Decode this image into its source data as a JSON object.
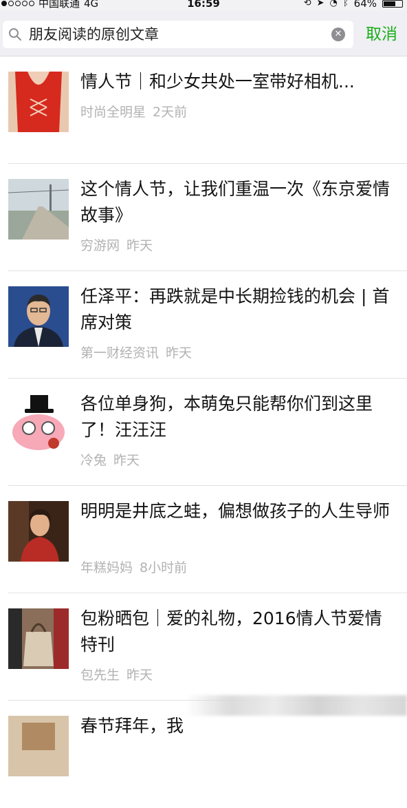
{
  "status_bar": {
    "carrier": "中国联通",
    "network": "4G",
    "time": "16:59",
    "battery": "64%",
    "battery_level": 0.64,
    "signal_bars_filled": 1,
    "signal_bars_total": 5
  },
  "search": {
    "query": "朋友阅读的原创文章",
    "cancel_label": "取消"
  },
  "colors": {
    "accent_green": "#1aad19",
    "meta_gray": "#b2b2b2"
  },
  "results": [
    {
      "title": "情人节｜和少女共处一室带好相机...",
      "source": "时尚全明星",
      "time": "2天前",
      "thumb": "red-dress"
    },
    {
      "title": "这个情人节，让我们重温一次《东京爱情故事》",
      "source": "穷游网",
      "time": "昨天",
      "thumb": "railway"
    },
    {
      "title": "任泽平：再跌就是中长期捡钱的机会 | 首席对策",
      "source": "第一财经资讯",
      "time": "昨天",
      "thumb": "man-portrait"
    },
    {
      "title": "各位单身狗，本萌兔只能帮你们到这里了！汪汪汪",
      "source": "冷兔",
      "time": "昨天",
      "thumb": "pink-rabbit"
    },
    {
      "title": "明明是井底之蛙，偏想做孩子的人生导师",
      "source": "年糕妈妈",
      "time": "8小时前",
      "thumb": "woman-portrait"
    },
    {
      "title": "包粉晒包｜爱的礼物，2016情人节爱情特刊",
      "source": "包先生",
      "time": "昨天",
      "thumb": "handbag"
    },
    {
      "title": "春节拜年，我",
      "source": "",
      "time": "",
      "thumb": "partial"
    }
  ]
}
